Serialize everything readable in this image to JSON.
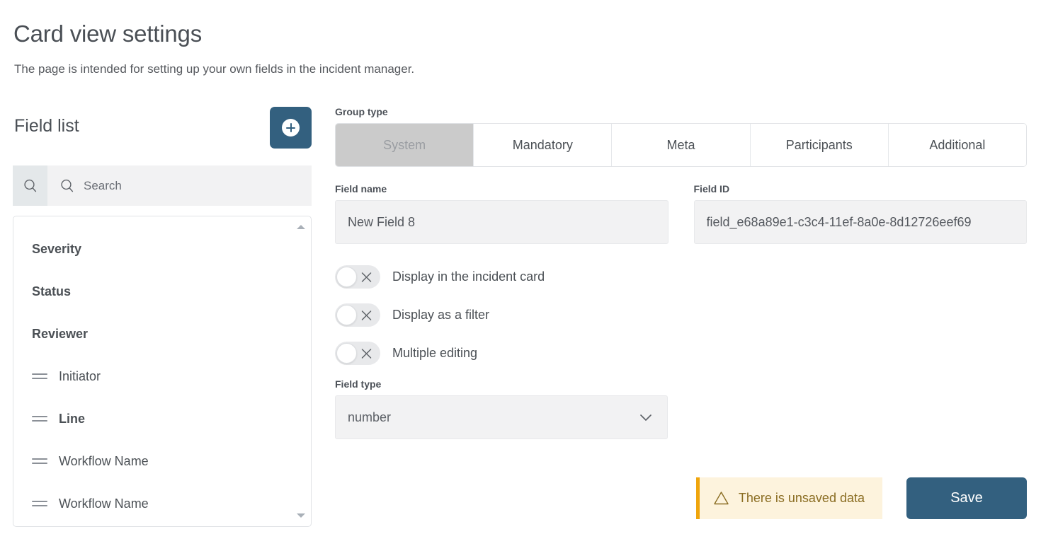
{
  "header": {
    "title": "Card view settings",
    "subtitle": "The page is intended for setting up your own fields in the incident manager."
  },
  "field_list_panel": {
    "title": "Field list",
    "add_button_label": "+",
    "add_icon": "plus-circle-icon",
    "search": {
      "button_icon": "search-icon",
      "input_icon": "search-icon",
      "placeholder": "Search",
      "value": ""
    },
    "scroll_up_icon": "triangle-up-icon",
    "scroll_down_icon": "triangle-down-icon",
    "items": [
      {
        "label": "Severity",
        "type": "group",
        "bold": true,
        "handle": false
      },
      {
        "label": "Status",
        "type": "group",
        "bold": true,
        "handle": false
      },
      {
        "label": "Reviewer",
        "type": "group",
        "bold": true,
        "handle": false
      },
      {
        "label": "Initiator",
        "type": "child",
        "bold": false,
        "handle": true
      },
      {
        "label": "Line",
        "type": "child",
        "bold": true,
        "handle": true
      },
      {
        "label": "Workflow Name",
        "type": "child",
        "bold": false,
        "handle": true
      },
      {
        "label": "Workflow Name",
        "type": "child",
        "bold": false,
        "handle": true
      }
    ]
  },
  "form": {
    "group_type": {
      "label": "Group type",
      "selected": "System",
      "tabs": [
        "System",
        "Mandatory",
        "Meta",
        "Participants",
        "Additional"
      ]
    },
    "field_name": {
      "label": "Field name",
      "value": "New Field 8",
      "placeholder": "Field name"
    },
    "field_id": {
      "label": "Field ID",
      "value": "field_e68a89e1-c3c4-11ef-8a0e-8d12726eef69",
      "placeholder": "Field ID"
    },
    "toggles": [
      {
        "label": "Display in the incident card",
        "state": "off",
        "icon": "close-x-icon"
      },
      {
        "label": "Display as a filter",
        "state": "off",
        "icon": "close-x-icon"
      },
      {
        "label": "Multiple editing",
        "state": "off",
        "icon": "close-x-icon"
      }
    ],
    "field_type": {
      "label": "Field type",
      "value": "number",
      "chevron_icon": "chevron-down-icon"
    }
  },
  "footer": {
    "warning": {
      "icon": "warning-triangle-icon",
      "text": "There is unsaved data"
    },
    "save_label": "Save"
  },
  "colors": {
    "accent": "#33607f",
    "tab_selected_bg": "#cbcbcb",
    "warning_bg": "#fdf3dd",
    "warning_border": "#efa50c",
    "warning_text": "#8a6d22",
    "input_bg": "#f2f2f3"
  }
}
